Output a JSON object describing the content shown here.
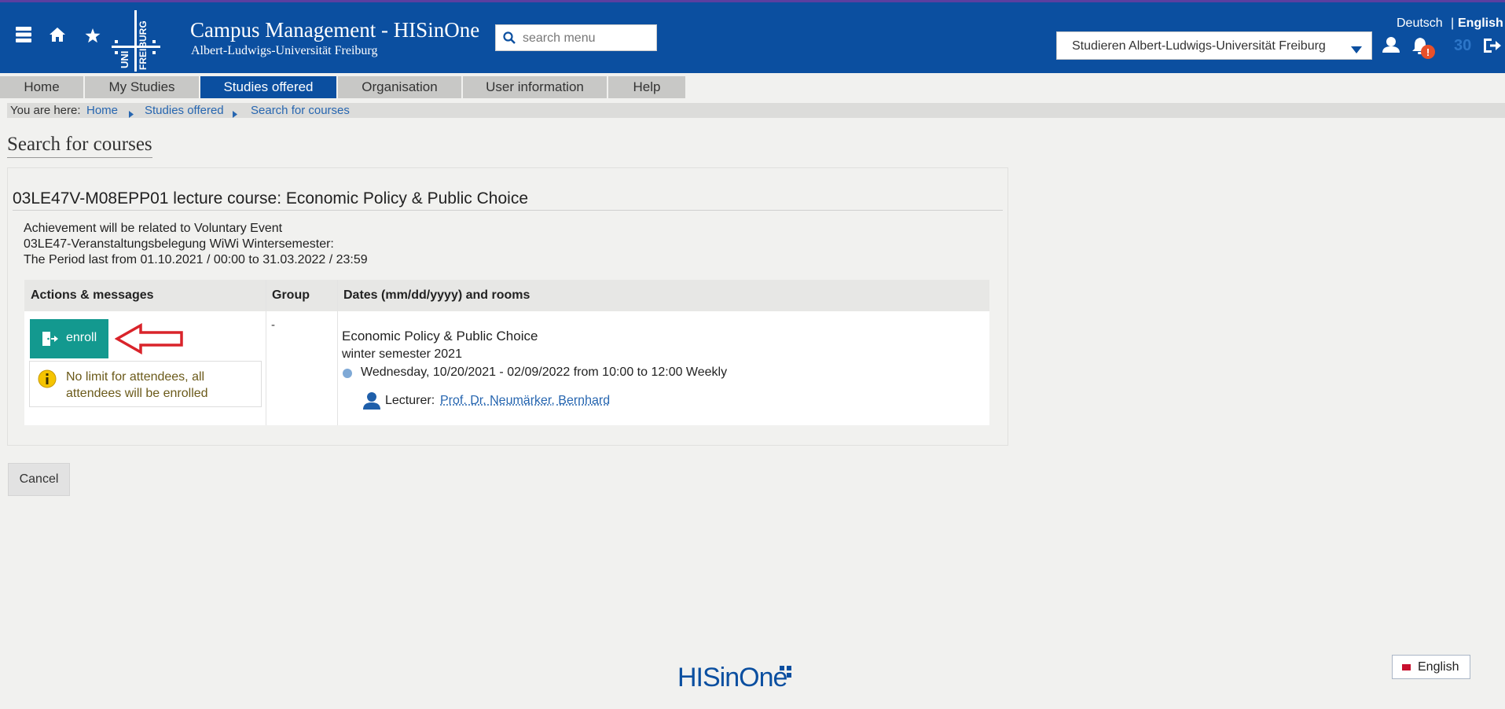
{
  "header": {
    "app_title": "Campus Management - HISinOne",
    "university": "Albert-Ludwigs-Universität Freiburg",
    "logo_text": "UNI FREIBURG",
    "search_placeholder": "search menu",
    "lang_de": "Deutsch",
    "lang_sep": "|",
    "lang_en": "English",
    "role_select": "Studieren Albert-Ludwigs-Universität Freiburg",
    "session_counter": "30",
    "notification_badge": "!",
    "icons": [
      "menu-icon",
      "home-icon",
      "star-icon",
      "search-icon",
      "chevron-down-icon",
      "user-icon",
      "bell-icon",
      "logout-icon"
    ]
  },
  "nav": {
    "tabs": [
      {
        "label": "Home",
        "active": false
      },
      {
        "label": "My Studies",
        "active": false
      },
      {
        "label": "Studies offered",
        "active": true
      },
      {
        "label": "Organisation",
        "active": false
      },
      {
        "label": "User information",
        "active": false
      },
      {
        "label": "Help",
        "active": false
      }
    ]
  },
  "breadcrumb": {
    "prefix": "You are here:",
    "items": [
      "Home",
      "Studies offered",
      "Search for courses"
    ]
  },
  "page": {
    "title": "Search for courses",
    "course_title": "03LE47V-M08EPP01 lecture course: Economic Policy & Public Choice",
    "info_lines": [
      "Achievement will be related to Voluntary Event",
      "03LE47-Veranstaltungsbelegung WiWi Wintersemester:",
      "The Period last from 01.10.2021 / 00:00 to 31.03.2022 / 23:59"
    ]
  },
  "table": {
    "headers": [
      "Actions & messages",
      "Group",
      "Dates (mm/dd/yyyy) and rooms"
    ],
    "enroll_label": "enroll",
    "notice": "No limit for attendees, all attendees will be enrolled",
    "group_value": "-",
    "event_title": "Economic Policy & Public Choice",
    "semester": "winter semester 2021",
    "date_line": "Wednesday, 10/20/2021 - 02/09/2022 from 10:00 to 12:00 Weekly",
    "lecturer_label": "Lecturer:",
    "lecturer_name": "Prof. Dr. Neumärker, Bernhard"
  },
  "actions": {
    "cancel_label": "Cancel"
  },
  "footer": {
    "logo_text": "HISinOne",
    "language_button": "English"
  },
  "colors": {
    "header_bg": "#0b4fa0",
    "active_tab": "#0b4fa0",
    "enroll_button": "#13998f",
    "link": "#2766b0",
    "annotation_arrow": "#d9232a"
  }
}
